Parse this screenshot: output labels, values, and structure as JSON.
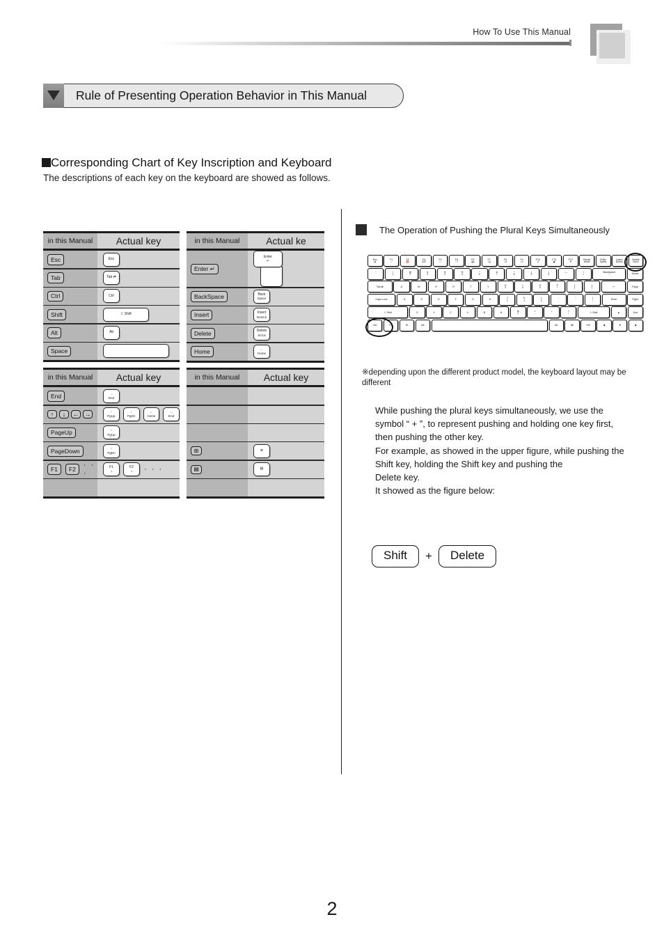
{
  "header": {
    "title": "How To Use This Manual"
  },
  "banner": {
    "icon": "triangle-down-icon",
    "title": "Rule of Presenting Operation Behavior in This Manual"
  },
  "section": {
    "bullet_icon": "square-bullet-icon",
    "heading": "Corresponding Chart of Key Inscription and Keyboard",
    "description": "The descriptions of each key on the keyboard are showed as follows."
  },
  "tables": [
    {
      "id": "table-1",
      "headers": [
        "in this Manual",
        "Actual key"
      ],
      "rows": [
        {
          "manual": "Esc",
          "actual": [
            {
              "top": "Esc",
              "bot": "",
              "w": "n"
            }
          ]
        },
        {
          "manual": "Tab",
          "actual": [
            {
              "top": "Tab ⇄",
              "bot": "",
              "w": "n"
            }
          ]
        },
        {
          "manual": "Ctrl",
          "actual": [
            {
              "top": "Ctrl",
              "bot": "",
              "w": "n"
            }
          ]
        },
        {
          "manual": "Shift",
          "actual": [
            {
              "top": "⇧ Shift",
              "bot": "",
              "w": "w"
            }
          ]
        },
        {
          "manual": "Alt",
          "actual": [
            {
              "top": "Alt",
              "bot": "",
              "w": "n"
            }
          ]
        },
        {
          "manual": "Space",
          "actual": [
            {
              "top": "",
              "bot": "",
              "w": "wide"
            }
          ]
        }
      ]
    },
    {
      "id": "table-2",
      "headers": [
        "in this Manual",
        "Actual ke"
      ],
      "rows": [
        {
          "manual": "Enter ↵",
          "actual": "enter-shape"
        },
        {
          "manual": "BackSpace",
          "actual": [
            {
              "top": "Back",
              "bot": "Space",
              "w": "n"
            }
          ]
        },
        {
          "manual": "Insert",
          "actual": [
            {
              "top": "Insert",
              "bot": "NumLk",
              "w": "n"
            }
          ]
        },
        {
          "manual": "Delete",
          "actual": [
            {
              "top": "Delete",
              "bot": "ScrLk",
              "w": "n"
            }
          ]
        },
        {
          "manual": "Home",
          "actual": [
            {
              "top": "←",
              "bot": "Home",
              "w": "n"
            }
          ]
        }
      ]
    },
    {
      "id": "table-3",
      "headers": [
        "in this Manual",
        "Actual key"
      ],
      "rows": [
        {
          "manual": "End",
          "actual": [
            {
              "top": "→",
              "bot": "End",
              "w": "n"
            }
          ]
        },
        {
          "manual": "arrows",
          "manual_keys": [
            "↑",
            "↓",
            "←",
            "→"
          ],
          "actual": [
            {
              "top": "↑",
              "bot": "PgUp",
              "w": "n"
            },
            {
              "top": "↓",
              "bot": "PgDn",
              "w": "n"
            },
            {
              "top": "←",
              "bot": "Home",
              "w": "n"
            },
            {
              "top": "→",
              "bot": "End",
              "w": "n"
            }
          ]
        },
        {
          "manual": "PageUp",
          "actual": [
            {
              "top": "↑",
              "bot": "PgUp",
              "w": "n"
            }
          ]
        },
        {
          "manual": "PageDown",
          "actual": [
            {
              "top": "↓",
              "bot": "PgDn",
              "w": "n"
            }
          ]
        },
        {
          "manual": "fkeys",
          "manual_keys": [
            "F1",
            "F2"
          ],
          "manual_ellipsis": "· · ·",
          "actual": [
            {
              "top": "F1",
              "bot": "☼",
              "w": "n"
            },
            {
              "top": "F2",
              "bot": "☼",
              "w": "n"
            }
          ],
          "actual_ellipsis": "· · ·"
        },
        {
          "manual": "",
          "actual": []
        }
      ]
    },
    {
      "id": "table-4",
      "headers": [
        "in this Manual",
        "Actual key"
      ],
      "rows": [
        {
          "manual": "",
          "actual": []
        },
        {
          "manual": "",
          "actual": []
        },
        {
          "manual": "",
          "actual": []
        },
        {
          "manual": "windows-key-icon",
          "manual_icon": "⊞",
          "actual_icon": "⊕"
        },
        {
          "manual": "menu-key-icon",
          "manual_icon": "▤",
          "actual_icon": "▤"
        },
        {
          "manual": "",
          "actual": []
        }
      ]
    }
  ],
  "right": {
    "bullet_icon": "square-bullet-icon",
    "heading": "The Operation of Pushing the Plural Keys Simultaneously",
    "keyboard_note": "※depending upon the different product model, the keyboard layout may be different",
    "body_lines": [
      "While pushing the plural keys simultaneously, we use the",
      "symbol “ + ”, to represent pushing and holding one key first,",
      "then pushing the other key.",
      "For example, as showed in the upper figure, while pushing the",
      "Shift key, holding the Shift key and pushing the",
      "Delete key.",
      "It showed as the figure below:"
    ],
    "combo": {
      "first_key": "Shift",
      "operator": "+",
      "second_key": "Delete"
    },
    "highlights": [
      "shift-key-circle",
      "delete-key-circle"
    ]
  },
  "keyboard": {
    "rows": [
      {
        "id": "function-row",
        "keys": [
          {
            "t": "Esc",
            "b": "▤"
          },
          {
            "t": "F1",
            "b": "♪"
          },
          {
            "t": "F2",
            "b": "♈"
          },
          {
            "t": "F3",
            "b": "ZZZ"
          },
          {
            "t": "F4",
            "b": "☼-"
          },
          {
            "t": "F5",
            "b": "☼+"
          },
          {
            "t": "F6",
            "b": "◀))"
          },
          {
            "t": "F7",
            "b": "◁))"
          },
          {
            "t": "F8",
            "b": "◁x"
          },
          {
            "t": "F9",
            "b": "◁«"
          },
          {
            "t": "F10",
            "b": "⏯"
          },
          {
            "t": "F11",
            "b": "▣"
          },
          {
            "t": "F12",
            "b": "▼"
          },
          {
            "t": "Pause",
            "b": "Break"
          },
          {
            "t": "PrtSc",
            "b": "SysRq"
          },
          {
            "t": "Insert",
            "b": "NumLk"
          },
          {
            "t": "Delete",
            "b": "ScrLk"
          }
        ]
      },
      {
        "id": "number-row",
        "keys": [
          {
            "t": "~",
            "b": "`"
          },
          {
            "t": "!",
            "b": "1"
          },
          {
            "t": "@",
            "b": "2"
          },
          {
            "t": "#",
            "b": "3"
          },
          {
            "t": "$",
            "b": "4"
          },
          {
            "t": "%",
            "b": "5"
          },
          {
            "t": "^",
            "b": "6"
          },
          {
            "t": "&",
            "b": "7"
          },
          {
            "t": "*",
            "b": "8"
          },
          {
            "t": "(",
            "b": "9"
          },
          {
            "t": ")",
            "b": "0"
          },
          {
            "t": "—",
            "b": "-"
          },
          {
            "t": "+",
            "b": "="
          },
          {
            "t": "Backspace",
            "b": "←",
            "w": "x2"
          },
          {
            "t": "Home",
            "b": ""
          }
        ]
      },
      {
        "id": "qwerty-row",
        "keys": [
          {
            "t": "Tab ⇄",
            "b": "",
            "w": "x15"
          },
          {
            "t": "Q",
            "b": ""
          },
          {
            "t": "W",
            "b": ""
          },
          {
            "t": "E",
            "b": ""
          },
          {
            "t": "R",
            "b": ""
          },
          {
            "t": "T",
            "b": ""
          },
          {
            "t": "Y",
            "b": ""
          },
          {
            "t": "U",
            "b": "4"
          },
          {
            "t": "I",
            "b": "5"
          },
          {
            "t": "O",
            "b": "6"
          },
          {
            "t": "P",
            "b": "*"
          },
          {
            "t": "{",
            "b": "["
          },
          {
            "t": "}",
            "b": "]"
          },
          {
            "t": "↵",
            "b": "",
            "w": "x15"
          },
          {
            "t": "PgUp",
            "b": ""
          }
        ]
      },
      {
        "id": "home-row",
        "keys": [
          {
            "t": "Caps Lock",
            "b": "",
            "w": "x17"
          },
          {
            "t": "A",
            "b": ""
          },
          {
            "t": "S",
            "b": ""
          },
          {
            "t": "D",
            "b": ""
          },
          {
            "t": "F",
            "b": ""
          },
          {
            "t": "G",
            "b": ""
          },
          {
            "t": "H",
            "b": ""
          },
          {
            "t": "J",
            "b": "1"
          },
          {
            "t": "K",
            "b": "2"
          },
          {
            "t": "L",
            "b": "3"
          },
          {
            "t": ":",
            "b": ";"
          },
          {
            "t": "\"",
            "b": "'"
          },
          {
            "t": "|",
            "b": "\\"
          },
          {
            "t": "Enter",
            "b": "",
            "w": "x15"
          },
          {
            "t": "PgDn",
            "b": ""
          }
        ]
      },
      {
        "id": "shift-row",
        "keys": [
          {
            "t": "⇧ Shift",
            "b": "",
            "w": "x25"
          },
          {
            "t": "Z",
            "b": ""
          },
          {
            "t": "X",
            "b": ""
          },
          {
            "t": "C",
            "b": ""
          },
          {
            "t": "V",
            "b": ""
          },
          {
            "t": "B",
            "b": ""
          },
          {
            "t": "N",
            "b": ""
          },
          {
            "t": "M",
            "b": "0"
          },
          {
            "t": "<",
            "b": ","
          },
          {
            "t": ">",
            "b": "."
          },
          {
            "t": "?",
            "b": "/"
          },
          {
            "t": "⇧ Shift",
            "b": "",
            "w": "x2"
          },
          {
            "t": "▲",
            "b": ""
          },
          {
            "t": "End",
            "b": ""
          }
        ]
      },
      {
        "id": "bottom-row",
        "keys": [
          {
            "t": "Ctrl",
            "b": ""
          },
          {
            "t": "Fn",
            "b": ""
          },
          {
            "t": "⊞",
            "b": ""
          },
          {
            "t": "Alt",
            "b": ""
          },
          {
            "t": "",
            "b": "",
            "w": "x75"
          },
          {
            "t": "Alt",
            "b": ""
          },
          {
            "t": "▤",
            "b": ""
          },
          {
            "t": "Ctrl",
            "b": ""
          },
          {
            "t": "◀",
            "b": ""
          },
          {
            "t": "▼",
            "b": ""
          },
          {
            "t": "▶",
            "b": ""
          }
        ]
      }
    ]
  },
  "footer": {
    "page_number": "2"
  }
}
